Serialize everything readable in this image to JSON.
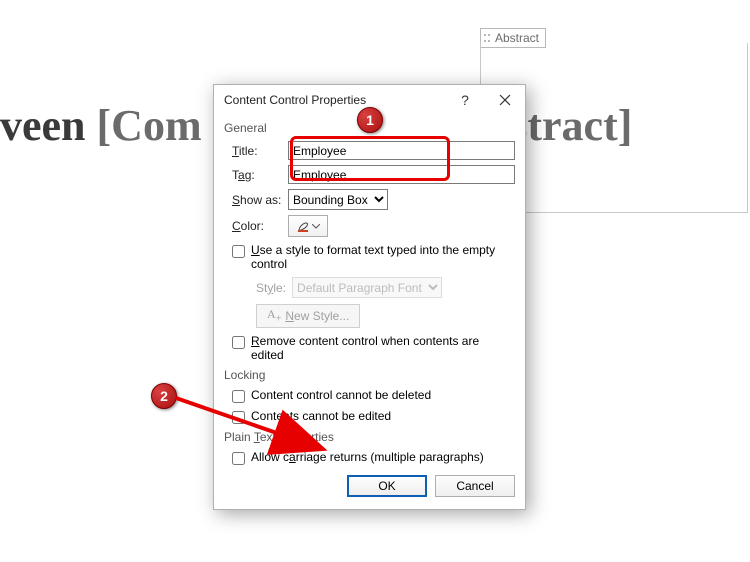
{
  "background": {
    "line_parts": [
      "veen ",
      "[Com",
      "Abstract]"
    ],
    "tag_label": "Abstract"
  },
  "dialog": {
    "title": "Content Control Properties",
    "help_icon": "?",
    "close_icon": "×",
    "general": {
      "label": "General",
      "title_label": "Title:",
      "title_value": "Employee",
      "tag_label": "Tag:",
      "tag_value": "Employee",
      "showas_label": "Show as:",
      "showas_value": "Bounding Box",
      "color_label": "Color:",
      "style_check": "Use a style to format text typed into the empty control",
      "style_label": "Style:",
      "style_value": "Default Paragraph Font",
      "new_style": "New Style...",
      "remove_check": "Remove content control when contents are edited"
    },
    "locking": {
      "label": "Locking",
      "cannot_delete": "Content control cannot be deleted",
      "cannot_edit": "Contents cannot be edited"
    },
    "plaintext": {
      "label": "Plain Text Properties",
      "carriage": "Allow carriage returns (multiple paragraphs)"
    },
    "buttons": {
      "ok": "OK",
      "cancel": "Cancel"
    }
  },
  "callouts": {
    "c1": "1",
    "c2": "2"
  }
}
